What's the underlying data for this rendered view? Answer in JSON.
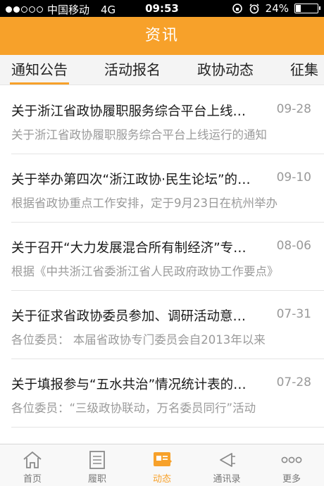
{
  "status": {
    "carrier": "中国移动",
    "network": "4G",
    "time": "09:53",
    "battery": "24%",
    "battery_level": 0.24
  },
  "header": {
    "title": "资讯"
  },
  "tabs": [
    {
      "label": "通知公告",
      "active": true
    },
    {
      "label": "活动报名",
      "active": false
    },
    {
      "label": "政协动态",
      "active": false
    },
    {
      "label": "征集",
      "active": false
    }
  ],
  "news": [
    {
      "title": "关于浙江省政协履职服务综合平台上线运行的通知",
      "date": "09-28",
      "summary": "关于浙江省政协履职服务综合平台上线运行的通知"
    },
    {
      "title": "关于举办第四次“浙江政协·民生论坛”的通知",
      "date": "09-10",
      "summary": "根据省政协重点工作安排，定于9月23日在杭州举办"
    },
    {
      "title": "关于召开“大力发展混合所有制经济”专题协商会的通知",
      "date": "08-06",
      "summary": "根据《中共浙江省委浙江省人民政府政协工作要点》"
    },
    {
      "title": "关于征求省政协委员参加、调研活动意见的通知",
      "date": "07-31",
      "summary": "各位委员：  本届省政协专门委员会自2013年以来"
    },
    {
      "title": "关于填报参与“五水共治”情况统计表的通知",
      "date": "07-28",
      "summary": "各位委员：“三级政协联动，万名委员同行”活动"
    }
  ],
  "nav": [
    {
      "label": "首页",
      "icon": "home-icon",
      "active": false
    },
    {
      "label": "履职",
      "icon": "document-icon",
      "active": false
    },
    {
      "label": "动态",
      "icon": "news-icon",
      "active": true
    },
    {
      "label": "通讯录",
      "icon": "contacts-icon",
      "active": false
    },
    {
      "label": "更多",
      "icon": "more-icon",
      "active": false
    }
  ],
  "colors": {
    "accent": "#f7a12a",
    "text": "#1a1a1a",
    "muted": "#9a9a9a"
  }
}
